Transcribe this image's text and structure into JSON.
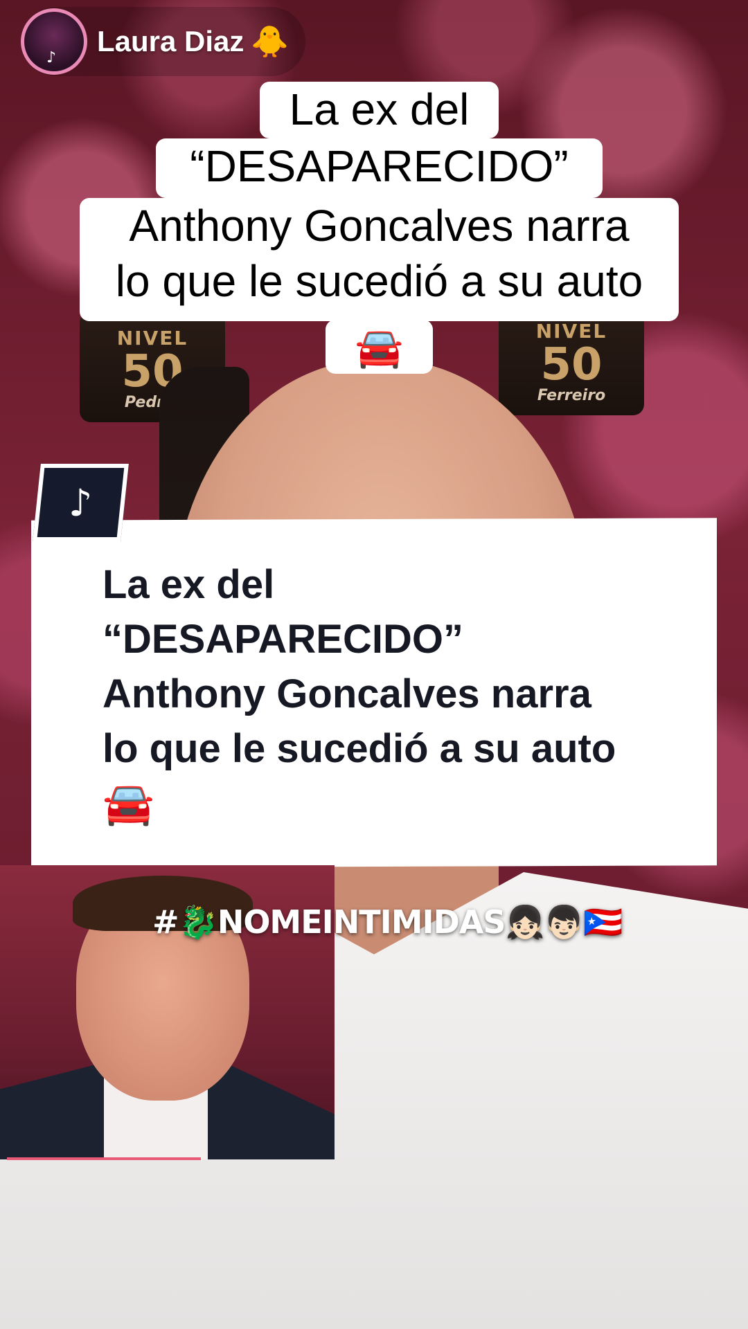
{
  "profile": {
    "name": "Laura Diaz",
    "emoji": "🐥"
  },
  "caption": {
    "line1": "La ex del",
    "line2": "“DESAPARECIDO”",
    "line3a": "Anthony Goncalves narra",
    "line3b": "lo que le sucedió a su auto",
    "emoji": "🚘"
  },
  "background": {
    "badge_left": {
      "level": "NIVEL",
      "number": "50",
      "name": "Pedrin"
    },
    "badge_right": {
      "level": "NIVEL",
      "number": "50",
      "name": "Ferreiro"
    }
  },
  "card": {
    "line1": "La ex del",
    "line2": "“DESAPARECIDO”",
    "line3": "Anthony Goncalves narra",
    "line4": "lo que le sucedió a su auto",
    "emoji": "🚘"
  },
  "hashtag": "#🐉NOMEINTIMIDAS👧🏻👦🏻🇵🇷",
  "icons": {
    "tiktok": "tiktok-logo-icon",
    "tiktok_glyph": "♪"
  },
  "colors": {
    "accent": "#e85a78",
    "card_text": "#161823",
    "tile": "#151a2c"
  }
}
